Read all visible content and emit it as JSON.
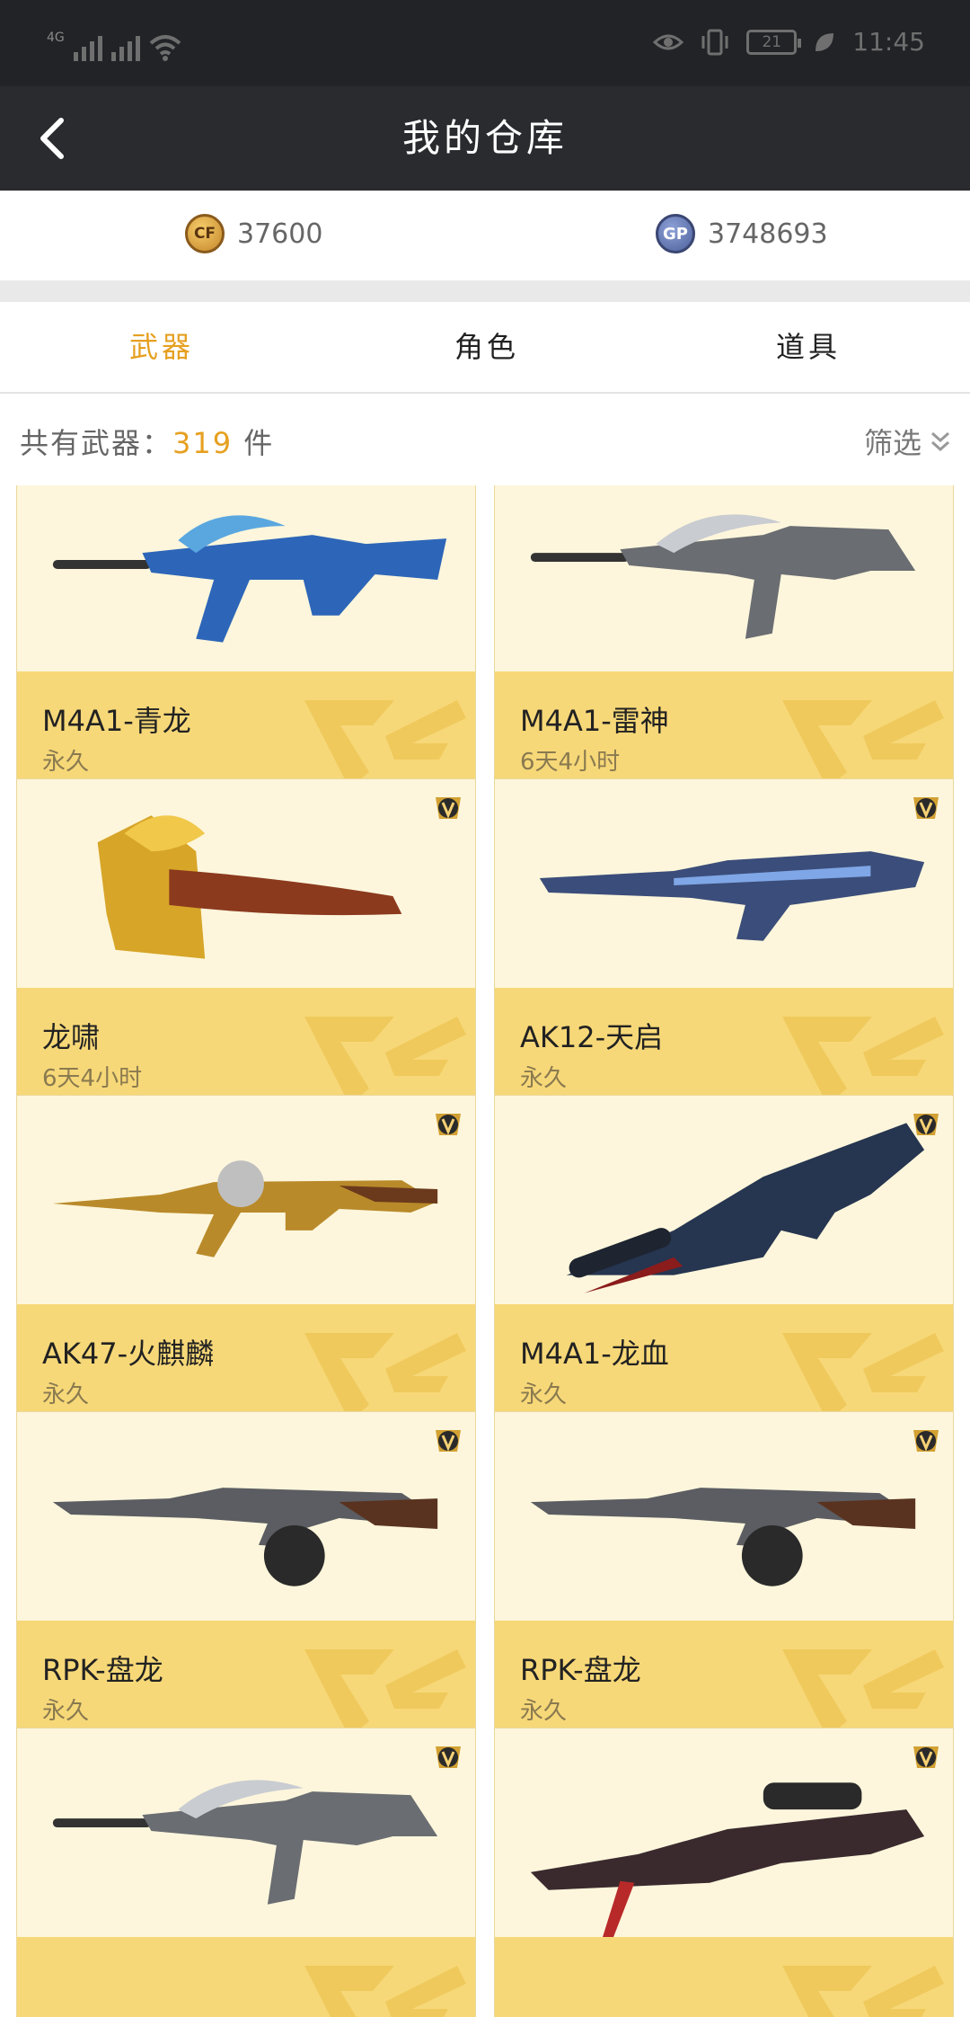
{
  "status": {
    "network": "4G",
    "battery": "21",
    "time": "11:45"
  },
  "nav": {
    "title": "我的仓库"
  },
  "currency": {
    "cf_value": "37600",
    "gp_value": "3748693",
    "gp_label": "GP"
  },
  "tabs": [
    {
      "label": "武器"
    },
    {
      "label": "角色"
    },
    {
      "label": "道具"
    }
  ],
  "summary": {
    "prefix": "共有武器：",
    "count": "319",
    "unit": "件"
  },
  "filter": {
    "label": "筛选"
  },
  "items": [
    {
      "name": "M4A1-青龙",
      "duration": "永久",
      "vip": false,
      "weapon": "rifle-blue"
    },
    {
      "name": "M4A1-雷神",
      "duration": "6天4小时",
      "vip": false,
      "weapon": "rifle-silver"
    },
    {
      "name": "龙啸",
      "duration": "6天4小时",
      "vip": true,
      "weapon": "axe-gold"
    },
    {
      "name": "AK12-天启",
      "duration": "永久",
      "vip": true,
      "weapon": "rifle-dark-blue"
    },
    {
      "name": "AK47-火麒麟",
      "duration": "永久",
      "vip": true,
      "weapon": "ak-gold"
    },
    {
      "name": "M4A1-龙血",
      "duration": "永久",
      "vip": true,
      "weapon": "rifle-black-red"
    },
    {
      "name": "RPK-盘龙",
      "duration": "永久",
      "vip": true,
      "weapon": "rpk-silver"
    },
    {
      "name": "RPK-盘龙",
      "duration": "永久",
      "vip": true,
      "weapon": "rpk-silver"
    },
    {
      "name": "",
      "duration": "",
      "vip": true,
      "weapon": "rifle-silver"
    },
    {
      "name": "",
      "duration": "",
      "vip": true,
      "weapon": "sniper-red"
    }
  ]
}
